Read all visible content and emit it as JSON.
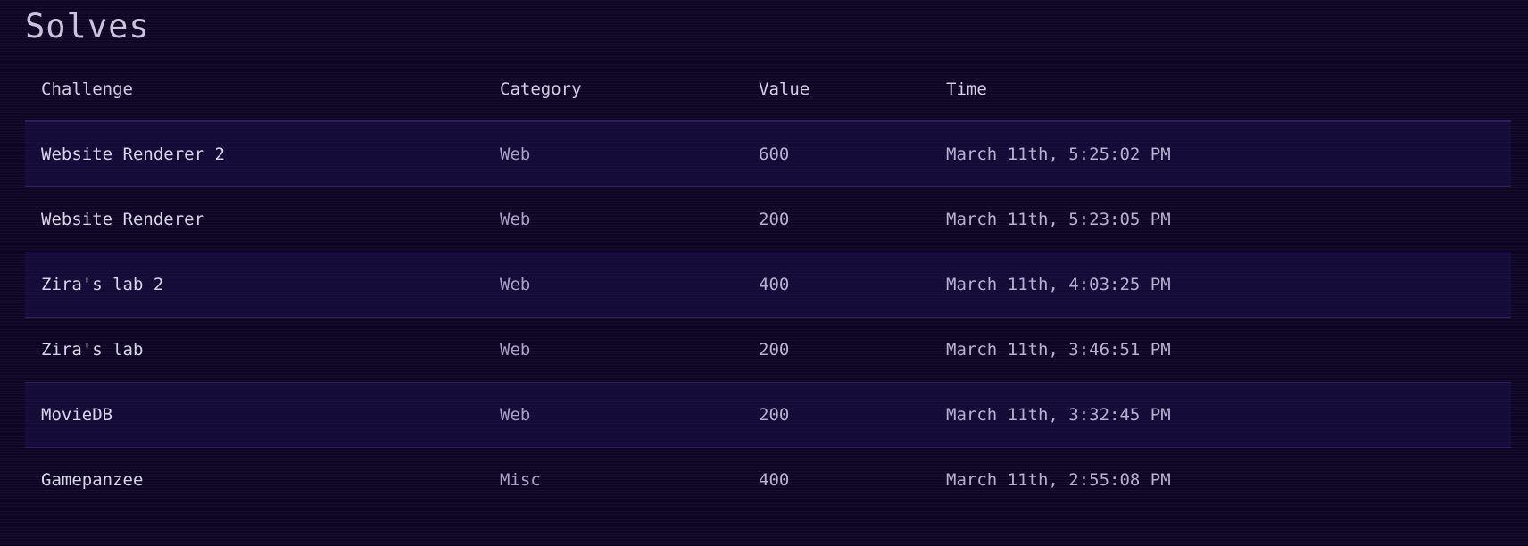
{
  "page": {
    "title": "Solves"
  },
  "table": {
    "columns": [
      "Challenge",
      "Category",
      "Value",
      "Time"
    ],
    "rows": [
      {
        "challenge": "Website Renderer 2",
        "category": "Web",
        "value": "600",
        "time": "March 11th, 5:25:02 PM"
      },
      {
        "challenge": "Website Renderer",
        "category": "Web",
        "value": "200",
        "time": "March 11th, 5:23:05 PM"
      },
      {
        "challenge": "Zira's lab 2",
        "category": "Web",
        "value": "400",
        "time": "March 11th, 4:03:25 PM"
      },
      {
        "challenge": "Zira's lab",
        "category": "Web",
        "value": "200",
        "time": "March 11th, 3:46:51 PM"
      },
      {
        "challenge": "MovieDB",
        "category": "Web",
        "value": "200",
        "time": "March 11th, 3:32:45 PM"
      },
      {
        "challenge": "Gamepanzee",
        "category": "Misc",
        "value": "400",
        "time": "March 11th, 2:55:08 PM"
      }
    ]
  },
  "colors": {
    "background": "#0d0524",
    "row_stripe": "#1c1048",
    "divider": "#2b1c61",
    "text": "#d6d1e6"
  }
}
